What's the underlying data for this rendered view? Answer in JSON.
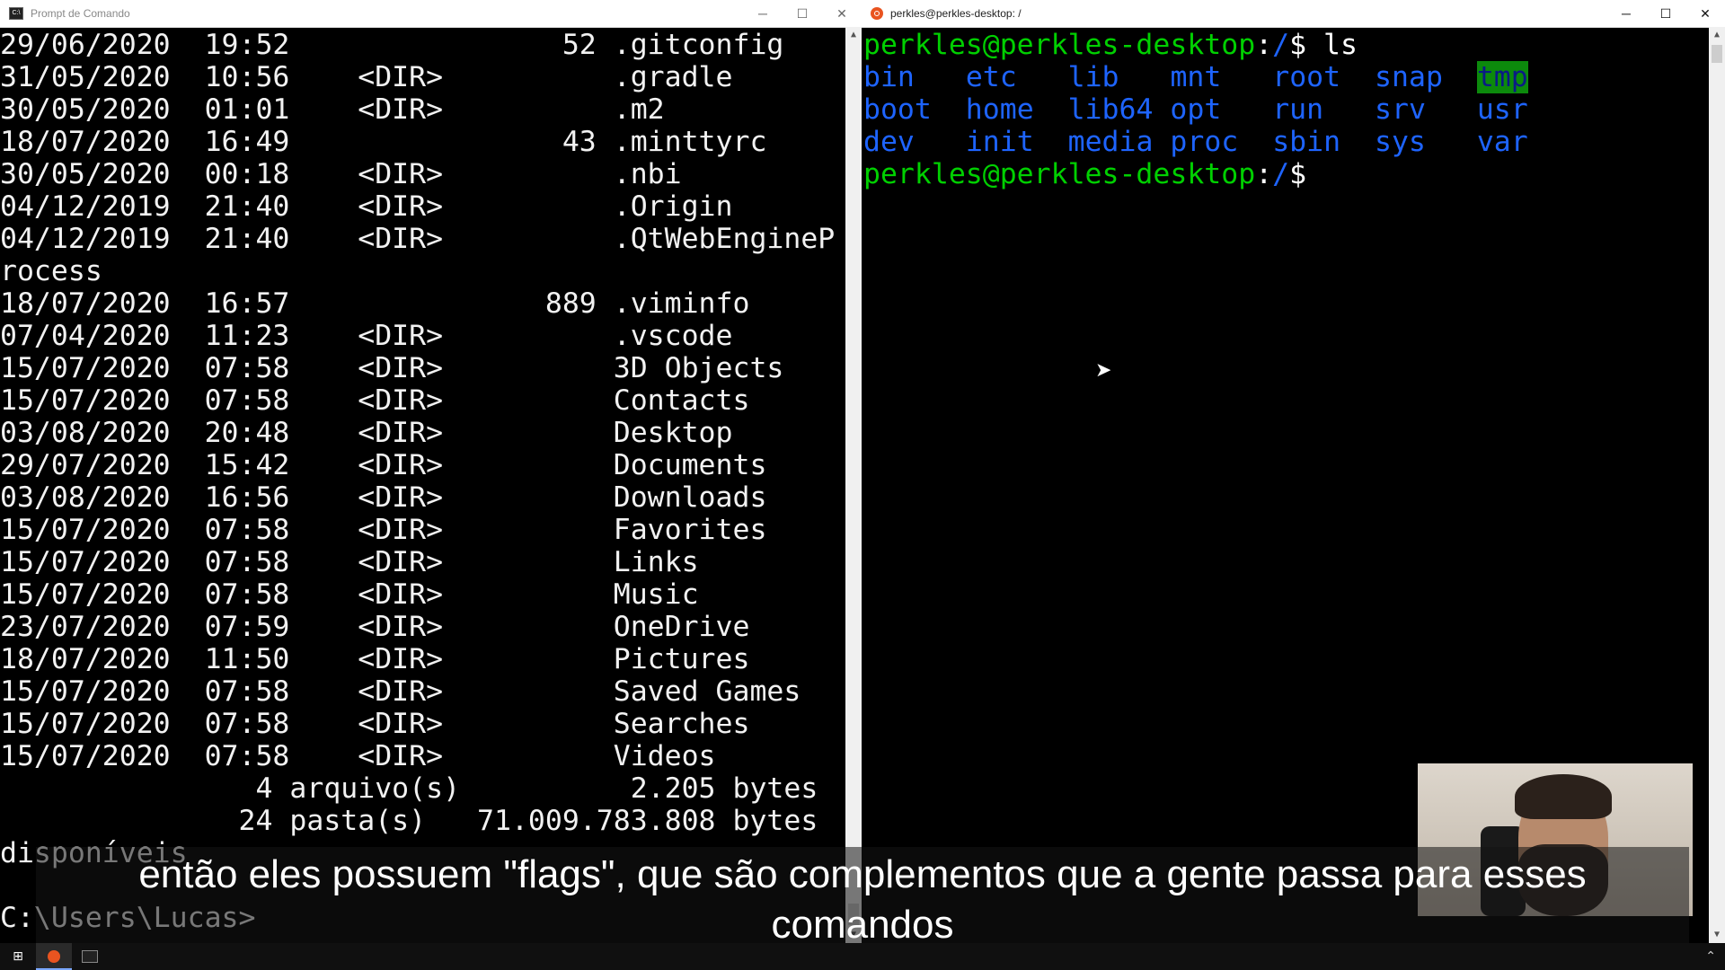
{
  "cmd_window": {
    "title": "Prompt de Comando",
    "icon": "cmd-icon",
    "lines": [
      "29/06/2020  19:52                52 .gitconfig",
      "31/05/2020  10:56    <DIR>          .gradle",
      "30/05/2020  01:01    <DIR>          .m2",
      "18/07/2020  16:49                43 .minttyrc",
      "30/05/2020  00:18    <DIR>          .nbi",
      "04/12/2019  21:40    <DIR>          .Origin",
      "04/12/2019  21:40    <DIR>          .QtWebEngineP",
      "rocess",
      "18/07/2020  16:57               889 .viminfo",
      "07/04/2020  11:23    <DIR>          .vscode",
      "15/07/2020  07:58    <DIR>          3D Objects",
      "15/07/2020  07:58    <DIR>          Contacts",
      "03/08/2020  20:48    <DIR>          Desktop",
      "29/07/2020  15:42    <DIR>          Documents",
      "03/08/2020  16:56    <DIR>          Downloads",
      "15/07/2020  07:58    <DIR>          Favorites",
      "15/07/2020  07:58    <DIR>          Links",
      "15/07/2020  07:58    <DIR>          Music",
      "23/07/2020  07:59    <DIR>          OneDrive",
      "18/07/2020  11:50    <DIR>          Pictures",
      "15/07/2020  07:58    <DIR>          Saved Games",
      "15/07/2020  07:58    <DIR>          Searches",
      "15/07/2020  07:58    <DIR>          Videos",
      "               4 arquivo(s)          2.205 bytes",
      "              24 pasta(s)   71.009.783.808 bytes",
      "disponíveis",
      "",
      "C:\\Users\\Lucas>"
    ]
  },
  "wsl_window": {
    "title": "perkles@perkles-desktop: /",
    "icon": "ubuntu-icon",
    "prompt_user": "perkles@perkles-desktop",
    "prompt_sep": ":",
    "prompt_path": "/",
    "prompt_symbol": "$",
    "command": " ls",
    "ls_rows": [
      [
        "bin",
        "etc",
        "lib",
        "mnt",
        "root",
        "snap",
        "tmp"
      ],
      [
        "boot",
        "home",
        "lib64",
        "opt",
        "run",
        "srv",
        "usr"
      ],
      [
        "dev",
        "init",
        "media",
        "proc",
        "sbin",
        "sys",
        "var"
      ]
    ],
    "highlighted_dir": "tmp"
  },
  "window_controls": {
    "minimize": "─",
    "maximize": "☐",
    "close": "✕"
  },
  "caption": {
    "line1": "então eles possuem \"flags\", que são complementos que a gente passa para esses",
    "line2": "comandos"
  },
  "taskbar": {
    "start_icon": "windows-start-icon",
    "ubuntu_icon": "ubuntu-taskbar-icon",
    "cmd_icon": "cmd-taskbar-icon",
    "tray_icon": "chevron-up-icon"
  },
  "colors": {
    "prompt_green": "#00d000",
    "dir_blue": "#1e64ff",
    "tmp_highlight": "#0c8a0c"
  }
}
